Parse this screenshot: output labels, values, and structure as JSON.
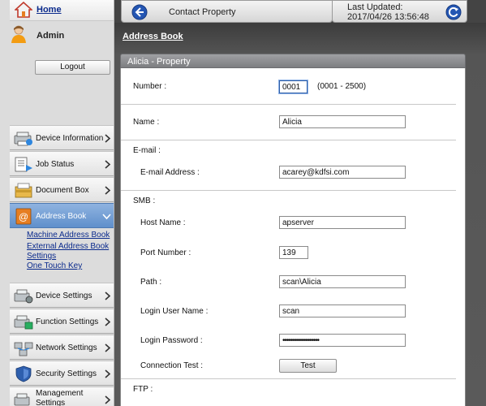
{
  "sidebar": {
    "home_label": "Home",
    "user_label": "Admin",
    "logout_label": "Logout",
    "items": [
      {
        "label": "Device Information",
        "icon": "device-info-icon"
      },
      {
        "label": "Job Status",
        "icon": "job-status-icon"
      },
      {
        "label": "Document Box",
        "icon": "document-box-icon"
      },
      {
        "label": "Address Book",
        "icon": "address-book-icon",
        "active": true
      },
      {
        "label": "Device Settings",
        "icon": "device-settings-icon"
      },
      {
        "label": "Function Settings",
        "icon": "function-settings-icon"
      },
      {
        "label": "Network Settings",
        "icon": "network-settings-icon"
      },
      {
        "label": "Security Settings",
        "icon": "security-settings-icon"
      },
      {
        "label_line1": "Management",
        "label_line2": "Settings",
        "icon": "management-settings-icon"
      }
    ],
    "sub_links": [
      "Machine Address Book",
      "External Address Book",
      "Settings",
      "One Touch Key"
    ]
  },
  "header": {
    "title": "Contact Property",
    "updated_label": "Last Updated:",
    "updated_value": "2017/04/26 13:56:48"
  },
  "breadcrumb": "Address Book",
  "panel_title": "Alicia - Property",
  "form": {
    "number_label": "Number :",
    "number_value": "0001",
    "number_range": "(0001 - 2500)",
    "name_label": "Name :",
    "name_value": "Alicia",
    "email_section": "E-mail :",
    "email_label": "E-mail Address :",
    "email_value": "acarey@kdfsi.com",
    "smb_section": "SMB :",
    "host_label": "Host Name :",
    "host_value": "apserver",
    "port_label": "Port Number :",
    "port_value": "139",
    "path_label": "Path :",
    "path_value": "scan\\Alicia",
    "login_user_label": "Login User Name :",
    "login_user_value": "scan",
    "login_pw_label": "Login Password :",
    "login_pw_value": "••••••••••••••••••",
    "conn_test_label": "Connection Test :",
    "test_button": "Test",
    "ftp_section": "FTP :"
  },
  "colors": {
    "active_nav": "#6f9bd4",
    "link": "#0a2a8c",
    "header_bg": "#444444"
  }
}
